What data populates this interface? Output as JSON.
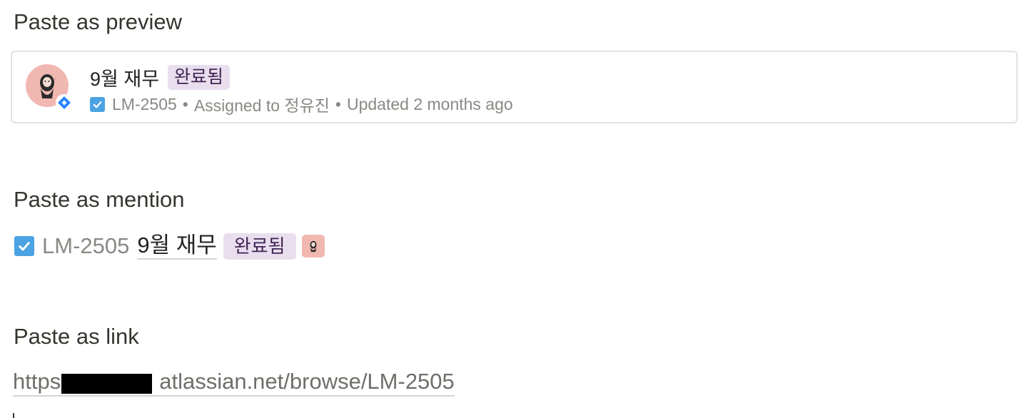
{
  "sections": {
    "preview_heading": "Paste as preview",
    "mention_heading": "Paste as mention",
    "link_heading": "Paste as link"
  },
  "issue": {
    "title": "9월 재무",
    "status": "완료됨",
    "key": "LM-2505",
    "assigned": "Assigned to 정유진",
    "updated": "Updated 2 months ago",
    "separator": "•"
  },
  "link": {
    "text": "https://[redacted].atlassian.net/browse/LM-2505",
    "prefix": "https",
    "suffix": "atlassian.net/browse/LM-2505"
  },
  "icons": {
    "avatar": "user-avatar-icon",
    "jira": "jira-logo-icon",
    "task": "task-checkbox-icon"
  },
  "colors": {
    "status_bg": "#e8deee",
    "status_text": "#412454",
    "task_blue": "#4ba3e3",
    "jira_blue": "#2684ff",
    "avatar_bg": "#f1b8b2"
  }
}
